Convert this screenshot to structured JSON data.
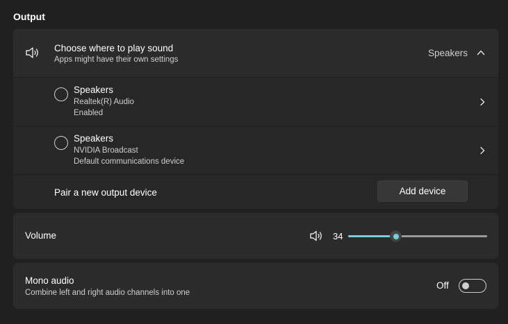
{
  "section": {
    "title": "Output"
  },
  "output": {
    "title": "Choose where to play sound",
    "subtitle": "Apps might have their own settings",
    "selected_value": "Speakers",
    "icons": {
      "speaker": "speaker-icon",
      "collapse": "chevron-up-icon"
    },
    "devices": [
      {
        "name": "Speakers",
        "line1": "Realtek(R) Audio",
        "line2": "Enabled",
        "selected": false
      },
      {
        "name": "Speakers",
        "line1": "NVIDIA Broadcast",
        "line2": "Default communications device",
        "selected": false
      }
    ],
    "pair": {
      "label": "Pair a new output device",
      "button": "Add device"
    }
  },
  "volume": {
    "label": "Volume",
    "value": "34",
    "level": 34,
    "max": 100,
    "accent": "#76d0dc"
  },
  "mono": {
    "title": "Mono audio",
    "subtitle": "Combine left and right audio channels into one",
    "state_label": "Off",
    "on": false
  }
}
